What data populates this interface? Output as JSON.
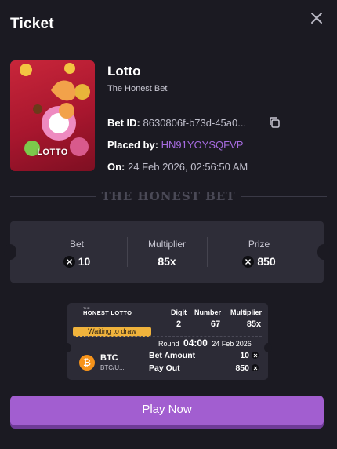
{
  "header": {
    "title": "Ticket",
    "close_icon": "close-icon"
  },
  "game": {
    "thumbnail_label": "LOTTO",
    "name": "Lotto",
    "subtitle": "The Honest Bet",
    "bet_id_label": "Bet ID:",
    "bet_id_value": "8630806f-b73d-45a0...",
    "copy_icon": "copy-icon",
    "placed_by_label": "Placed by:",
    "placed_by_value": "HN91YOYSQFVP",
    "on_label": "On:",
    "on_value": "24 Feb 2026, 02:56:50 AM"
  },
  "divider_text": "THE HONEST BET",
  "summary": {
    "bet_label": "Bet",
    "bet_value": "10",
    "multiplier_label": "Multiplier",
    "multiplier_value": "85x",
    "prize_label": "Prize",
    "prize_value": "850"
  },
  "mini_ticket": {
    "logo_small": "THE",
    "logo": "HONEST LOTTO",
    "digit_label": "Digit",
    "digit_value": "2",
    "number_label": "Number",
    "number_value": "67",
    "multiplier_label": "Multiplier",
    "multiplier_value": "85x",
    "status": "Waiting to draw",
    "round_label": "Round",
    "round_time": "04:00",
    "round_date": "24 Feb 2026",
    "coin_symbol": "₿",
    "coin_name": "BTC",
    "coin_pair": "BTC/U...",
    "bet_amount_label": "Bet Amount",
    "bet_amount_value": "10",
    "payout_label": "Pay Out",
    "payout_value": "850"
  },
  "play_button": "Play Now",
  "colors": {
    "background": "#1b1a22",
    "card": "#2e2d38",
    "accent": "#a25ed0",
    "link": "#a66be0",
    "badge": "#f0b33c",
    "btc": "#f7931a"
  }
}
